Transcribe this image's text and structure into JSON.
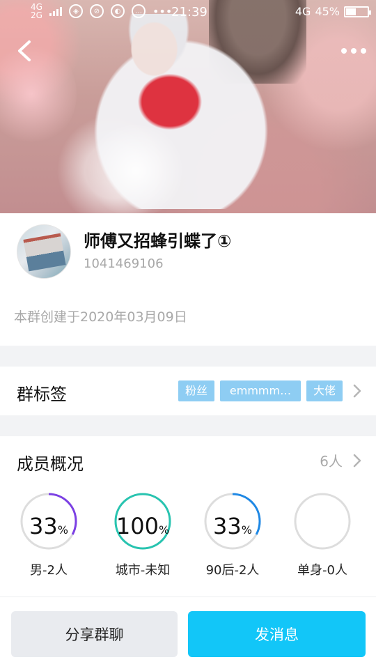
{
  "status_bar": {
    "network_label_1": "4G",
    "network_label_2": "2G",
    "time": "21:39",
    "network_right": "4G",
    "battery_percent": "45%",
    "battery_level": 0.45
  },
  "group": {
    "name": "师傅又招蜂引蝶了①",
    "id": "1041469106",
    "created": "本群创建于2020年03月09日"
  },
  "tags": {
    "title": "群标签",
    "items": [
      "粉丝",
      "emmmm…",
      "大佬"
    ]
  },
  "members": {
    "title": "成员概况",
    "count": "6人",
    "stats": [
      {
        "value": "33",
        "unit": "%",
        "label": "男-2人",
        "fraction": 0.33,
        "color": "#7b3fe4"
      },
      {
        "value": "100",
        "unit": "%",
        "label": "城市-未知",
        "fraction": 1.0,
        "color": "#27c4b0"
      },
      {
        "value": "33",
        "unit": "%",
        "label": "90后-2人",
        "fraction": 0.33,
        "color": "#1e88e5"
      },
      {
        "value": "",
        "unit": "",
        "label": "单身-0人",
        "fraction": 0.0,
        "color": "#dddddd"
      }
    ]
  },
  "actions": {
    "share": "分享群聊",
    "send": "发消息"
  }
}
